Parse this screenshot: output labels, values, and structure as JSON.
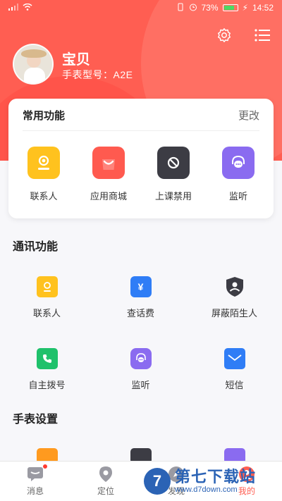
{
  "status_bar": {
    "battery": "73%",
    "time": "14:52"
  },
  "profile": {
    "name": "宝贝",
    "model": "手表型号：A2E"
  },
  "common": {
    "title": "常用功能",
    "edit": "更改",
    "items": [
      {
        "label": "联系人",
        "icon": "contact-icon",
        "color": "#ffc21e"
      },
      {
        "label": "应用商城",
        "icon": "shopping-bag-icon",
        "color": "#ff5a4f"
      },
      {
        "label": "上课禁用",
        "icon": "watch-ban-icon",
        "color": "#3c3c44"
      },
      {
        "label": "监听",
        "icon": "headset-icon",
        "color": "#8a6bf0"
      }
    ]
  },
  "comm": {
    "title": "通讯功能",
    "row1": [
      {
        "label": "联系人",
        "icon": "contact-icon"
      },
      {
        "label": "查话费",
        "icon": "watch-yen-icon"
      },
      {
        "label": "屏蔽陌生人",
        "icon": "shield-user-icon"
      }
    ],
    "row2": [
      {
        "label": "自主拨号",
        "icon": "phone-icon"
      },
      {
        "label": "监听",
        "icon": "headset-icon"
      },
      {
        "label": "短信",
        "icon": "mail-icon"
      }
    ]
  },
  "watch_settings": {
    "title": "手表设置"
  },
  "nav": [
    {
      "label": "消息",
      "icon": "message-icon"
    },
    {
      "label": "定位",
      "icon": "location-icon"
    },
    {
      "label": "发现",
      "icon": "discover-icon"
    },
    {
      "label": "我的",
      "icon": "profile-icon"
    }
  ],
  "watermark": {
    "title": "第七下载站",
    "url": "www.d7down.com"
  }
}
